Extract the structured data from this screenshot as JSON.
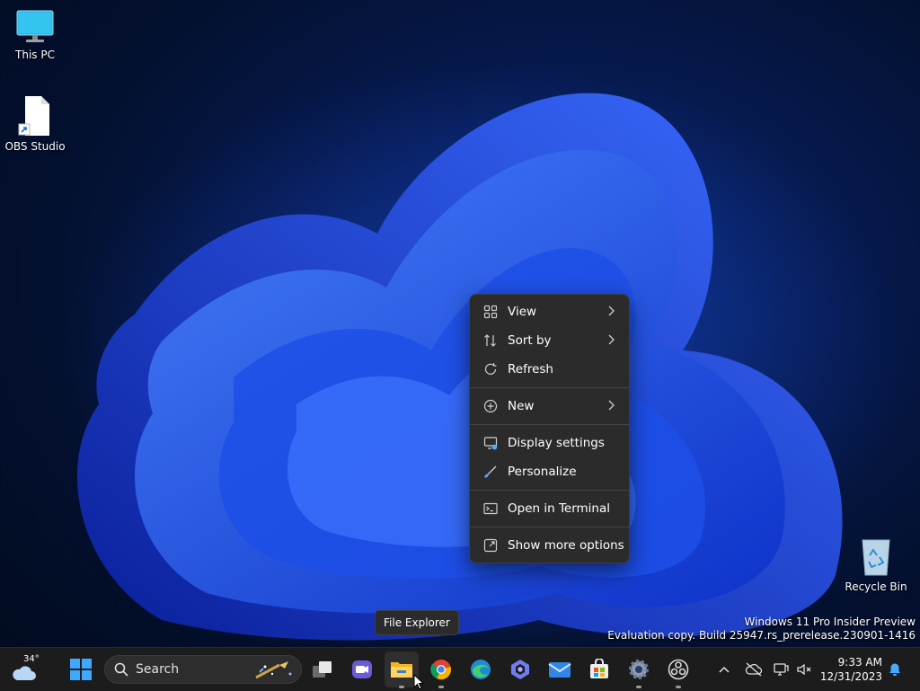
{
  "desktop": {
    "icons": [
      {
        "label": "This PC",
        "icon": "monitor-icon"
      },
      {
        "label": "OBS Studio",
        "icon": "shortcut-file-icon"
      },
      {
        "label": "Recycle Bin",
        "icon": "recycle-bin-icon"
      }
    ],
    "watermark": {
      "line1": "Windows 11 Pro Insider Preview",
      "line2": "Evaluation copy. Build 25947.rs_prerelease.230901-1416"
    }
  },
  "context_menu": {
    "items": [
      {
        "label": "View",
        "icon": "grid-icon",
        "submenu": true
      },
      {
        "label": "Sort by",
        "icon": "sort-icon",
        "submenu": true
      },
      {
        "label": "Refresh",
        "icon": "refresh-icon",
        "submenu": false
      },
      {
        "label": "New",
        "icon": "plus-circle-icon",
        "submenu": true
      },
      {
        "label": "Display settings",
        "icon": "display-settings-icon",
        "submenu": false
      },
      {
        "label": "Personalize",
        "icon": "brush-icon",
        "submenu": false
      },
      {
        "label": "Open in Terminal",
        "icon": "terminal-icon",
        "submenu": false
      },
      {
        "label": "Show more options",
        "icon": "more-options-icon",
        "submenu": false
      }
    ]
  },
  "tooltip": {
    "text": "File Explorer"
  },
  "taskbar": {
    "weather_temp": "34°",
    "search_placeholder": "Search",
    "clock_time": "9:33 AM",
    "clock_date": "12/31/2023"
  }
}
